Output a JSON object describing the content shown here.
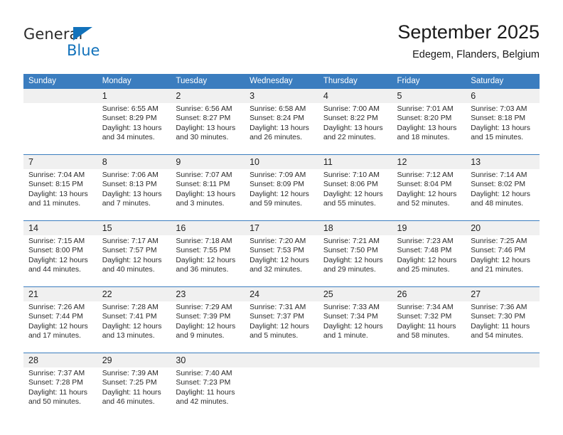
{
  "brand": {
    "name_part1": "General",
    "name_part2": "Blue",
    "accent_color": "#1272bb"
  },
  "header": {
    "title": "September 2025",
    "subtitle": "Edegem, Flanders, Belgium"
  },
  "theme": {
    "header_blue": "#3b7dbf",
    "daynum_gray": "#f0f0f0"
  },
  "weekdays": [
    "Sunday",
    "Monday",
    "Tuesday",
    "Wednesday",
    "Thursday",
    "Friday",
    "Saturday"
  ],
  "weeks": [
    {
      "days": [
        {
          "num": "",
          "sunrise": "",
          "sunset": "",
          "daylight": "",
          "empty": true
        },
        {
          "num": "1",
          "sunrise": "Sunrise: 6:55 AM",
          "sunset": "Sunset: 8:29 PM",
          "daylight": "Daylight: 13 hours and 34 minutes."
        },
        {
          "num": "2",
          "sunrise": "Sunrise: 6:56 AM",
          "sunset": "Sunset: 8:27 PM",
          "daylight": "Daylight: 13 hours and 30 minutes."
        },
        {
          "num": "3",
          "sunrise": "Sunrise: 6:58 AM",
          "sunset": "Sunset: 8:24 PM",
          "daylight": "Daylight: 13 hours and 26 minutes."
        },
        {
          "num": "4",
          "sunrise": "Sunrise: 7:00 AM",
          "sunset": "Sunset: 8:22 PM",
          "daylight": "Daylight: 13 hours and 22 minutes."
        },
        {
          "num": "5",
          "sunrise": "Sunrise: 7:01 AM",
          "sunset": "Sunset: 8:20 PM",
          "daylight": "Daylight: 13 hours and 18 minutes."
        },
        {
          "num": "6",
          "sunrise": "Sunrise: 7:03 AM",
          "sunset": "Sunset: 8:18 PM",
          "daylight": "Daylight: 13 hours and 15 minutes."
        }
      ]
    },
    {
      "days": [
        {
          "num": "7",
          "sunrise": "Sunrise: 7:04 AM",
          "sunset": "Sunset: 8:15 PM",
          "daylight": "Daylight: 13 hours and 11 minutes."
        },
        {
          "num": "8",
          "sunrise": "Sunrise: 7:06 AM",
          "sunset": "Sunset: 8:13 PM",
          "daylight": "Daylight: 13 hours and 7 minutes."
        },
        {
          "num": "9",
          "sunrise": "Sunrise: 7:07 AM",
          "sunset": "Sunset: 8:11 PM",
          "daylight": "Daylight: 13 hours and 3 minutes."
        },
        {
          "num": "10",
          "sunrise": "Sunrise: 7:09 AM",
          "sunset": "Sunset: 8:09 PM",
          "daylight": "Daylight: 12 hours and 59 minutes."
        },
        {
          "num": "11",
          "sunrise": "Sunrise: 7:10 AM",
          "sunset": "Sunset: 8:06 PM",
          "daylight": "Daylight: 12 hours and 55 minutes."
        },
        {
          "num": "12",
          "sunrise": "Sunrise: 7:12 AM",
          "sunset": "Sunset: 8:04 PM",
          "daylight": "Daylight: 12 hours and 52 minutes."
        },
        {
          "num": "13",
          "sunrise": "Sunrise: 7:14 AM",
          "sunset": "Sunset: 8:02 PM",
          "daylight": "Daylight: 12 hours and 48 minutes."
        }
      ]
    },
    {
      "days": [
        {
          "num": "14",
          "sunrise": "Sunrise: 7:15 AM",
          "sunset": "Sunset: 8:00 PM",
          "daylight": "Daylight: 12 hours and 44 minutes."
        },
        {
          "num": "15",
          "sunrise": "Sunrise: 7:17 AM",
          "sunset": "Sunset: 7:57 PM",
          "daylight": "Daylight: 12 hours and 40 minutes."
        },
        {
          "num": "16",
          "sunrise": "Sunrise: 7:18 AM",
          "sunset": "Sunset: 7:55 PM",
          "daylight": "Daylight: 12 hours and 36 minutes."
        },
        {
          "num": "17",
          "sunrise": "Sunrise: 7:20 AM",
          "sunset": "Sunset: 7:53 PM",
          "daylight": "Daylight: 12 hours and 32 minutes."
        },
        {
          "num": "18",
          "sunrise": "Sunrise: 7:21 AM",
          "sunset": "Sunset: 7:50 PM",
          "daylight": "Daylight: 12 hours and 29 minutes."
        },
        {
          "num": "19",
          "sunrise": "Sunrise: 7:23 AM",
          "sunset": "Sunset: 7:48 PM",
          "daylight": "Daylight: 12 hours and 25 minutes."
        },
        {
          "num": "20",
          "sunrise": "Sunrise: 7:25 AM",
          "sunset": "Sunset: 7:46 PM",
          "daylight": "Daylight: 12 hours and 21 minutes."
        }
      ]
    },
    {
      "days": [
        {
          "num": "21",
          "sunrise": "Sunrise: 7:26 AM",
          "sunset": "Sunset: 7:44 PM",
          "daylight": "Daylight: 12 hours and 17 minutes."
        },
        {
          "num": "22",
          "sunrise": "Sunrise: 7:28 AM",
          "sunset": "Sunset: 7:41 PM",
          "daylight": "Daylight: 12 hours and 13 minutes."
        },
        {
          "num": "23",
          "sunrise": "Sunrise: 7:29 AM",
          "sunset": "Sunset: 7:39 PM",
          "daylight": "Daylight: 12 hours and 9 minutes."
        },
        {
          "num": "24",
          "sunrise": "Sunrise: 7:31 AM",
          "sunset": "Sunset: 7:37 PM",
          "daylight": "Daylight: 12 hours and 5 minutes."
        },
        {
          "num": "25",
          "sunrise": "Sunrise: 7:33 AM",
          "sunset": "Sunset: 7:34 PM",
          "daylight": "Daylight: 12 hours and 1 minute."
        },
        {
          "num": "26",
          "sunrise": "Sunrise: 7:34 AM",
          "sunset": "Sunset: 7:32 PM",
          "daylight": "Daylight: 11 hours and 58 minutes."
        },
        {
          "num": "27",
          "sunrise": "Sunrise: 7:36 AM",
          "sunset": "Sunset: 7:30 PM",
          "daylight": "Daylight: 11 hours and 54 minutes."
        }
      ]
    },
    {
      "days": [
        {
          "num": "28",
          "sunrise": "Sunrise: 7:37 AM",
          "sunset": "Sunset: 7:28 PM",
          "daylight": "Daylight: 11 hours and 50 minutes."
        },
        {
          "num": "29",
          "sunrise": "Sunrise: 7:39 AM",
          "sunset": "Sunset: 7:25 PM",
          "daylight": "Daylight: 11 hours and 46 minutes."
        },
        {
          "num": "30",
          "sunrise": "Sunrise: 7:40 AM",
          "sunset": "Sunset: 7:23 PM",
          "daylight": "Daylight: 11 hours and 42 minutes."
        },
        {
          "num": "",
          "sunrise": "",
          "sunset": "",
          "daylight": "",
          "empty": true
        },
        {
          "num": "",
          "sunrise": "",
          "sunset": "",
          "daylight": "",
          "empty": true
        },
        {
          "num": "",
          "sunrise": "",
          "sunset": "",
          "daylight": "",
          "empty": true
        },
        {
          "num": "",
          "sunrise": "",
          "sunset": "",
          "daylight": "",
          "empty": true
        }
      ]
    }
  ]
}
